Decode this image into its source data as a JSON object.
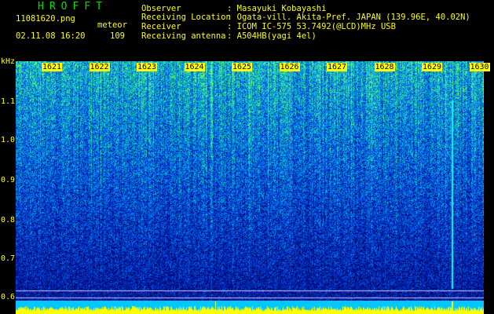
{
  "header": {
    "logo": "HROFFT",
    "filename": "11081620.png",
    "datetime": "02.11.08 16:20",
    "meteor_label": "meteor",
    "meteor_count": "109",
    "observer_label": "Observer",
    "observer_value": ": Masayuki Kobayashi",
    "location_label": "Receiving Location",
    "location_value": ": Ogata-vill. Akita-Pref. JAPAN (139.96E, 40.02N)",
    "receiver_label": "Receiver",
    "receiver_value": ": ICOM IC-575 53.7492(@LCD)MHz USB",
    "antenna_label": "Receiving antenna",
    "antenna_value": ": A504HB(yagi 4el)"
  },
  "axis": {
    "y_unit": "kHz",
    "y_ticks": [
      "1.1",
      "1.0",
      "0.9",
      "0.8",
      "0.7",
      "0.6"
    ],
    "x_ticks": [
      "1621",
      "1622",
      "1623",
      "1624",
      "1625",
      "1626",
      "1627",
      "1628",
      "1629",
      "1630"
    ]
  },
  "colors": {
    "background": "#000000",
    "text": "#ffff00",
    "logo": "#00e000",
    "spectrogram_low": "#000a6e",
    "spectrogram_high": "#40ff80",
    "meteor_echo": "#ff3030"
  }
}
